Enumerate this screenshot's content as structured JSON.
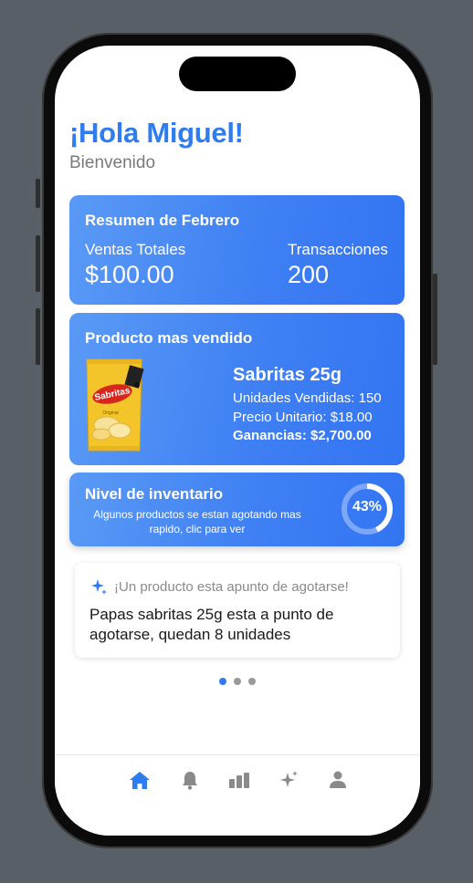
{
  "header": {
    "greeting": "¡Hola Miguel!",
    "subtitle": "Bienvenido"
  },
  "summary": {
    "title": "Resumen de Febrero",
    "sales_label": "Ventas Totales",
    "sales_value": "$100.00",
    "transactions_label": "Transacciones",
    "transactions_value": "200"
  },
  "top_product": {
    "title": "Producto mas vendido",
    "name": "Sabritas 25g",
    "units": "Unidades Vendidas:  150",
    "unit_price": "Precio Unitario: $18.00",
    "profit": "Ganancias: $2,700.00",
    "bag_brand": "Sabritas",
    "bag_flavor": "Original"
  },
  "inventory": {
    "title": "Nivel de inventario",
    "description": "Algunos productos se estan agotando mas rapido, clic para ver",
    "percent_label": "43%",
    "percent_value": 0.43
  },
  "alert": {
    "header": "¡Un producto esta apunto de agotarse!",
    "body": "Papas sabritas 25g esta a punto de agotarse, quedan 8 unidades"
  },
  "pager": {
    "count": 3,
    "active_index": 0
  },
  "tabbar": {
    "items": [
      {
        "icon": "home-icon",
        "active": true
      },
      {
        "icon": "bell-icon",
        "active": false
      },
      {
        "icon": "bar-chart-icon",
        "active": false
      },
      {
        "icon": "sparkles-icon",
        "active": false
      },
      {
        "icon": "person-icon",
        "active": false
      }
    ]
  },
  "colors": {
    "accent": "#2f7bf0",
    "card_start": "#5a9af5",
    "card_end": "#3374f2",
    "inactive_icon": "#8a8a8a"
  }
}
